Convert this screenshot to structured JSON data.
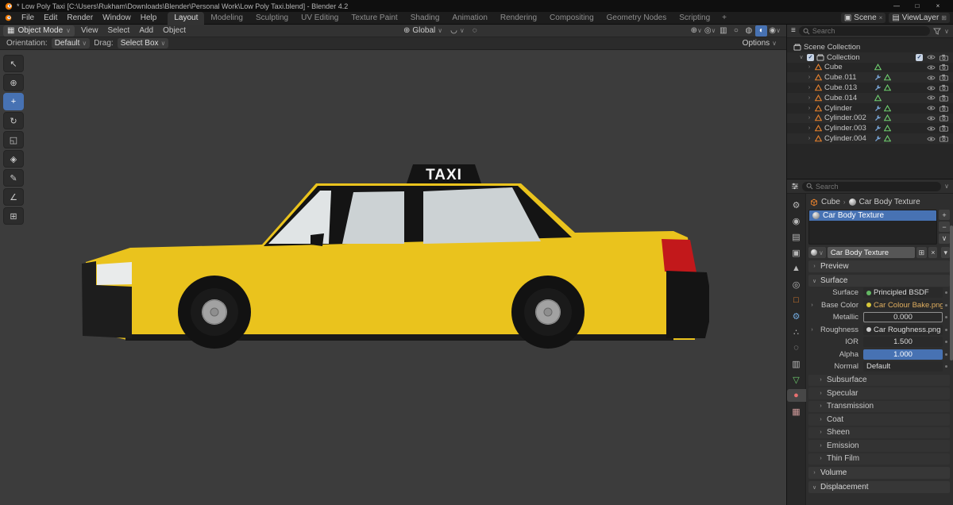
{
  "colors": {
    "accent": "#4772b3",
    "taxi_body": "#eac31d",
    "taxi_glass": "#ccd2d4",
    "taxi_windshield": "#e0e4e5",
    "taxi_taillight": "#c2181b",
    "viewport_bg": "#3c3c3c"
  },
  "icons": {
    "minimize": "—",
    "maximize": "□",
    "close": "×",
    "dropdown": "∨",
    "expand": "›",
    "open": "∨",
    "plus": "+",
    "minus": "−",
    "copy": "⊞",
    "crumb_sep": "›",
    "grid": "▦",
    "globe": "⊕",
    "magnet": "◡",
    "prop_edit": "◌",
    "scene_glyph": "▣",
    "layers_glyph": "▤",
    "funnel": "▾",
    "editor_outliner": "≡"
  },
  "titlebar": {
    "title": "* Low Poly Taxi [C:\\Users\\Rukham\\Downloads\\Blender\\Personal Work\\Low Poly Taxi.blend] - Blender 4.2"
  },
  "topbar": {
    "menus": [
      "File",
      "Edit",
      "Render",
      "Window",
      "Help"
    ],
    "workspaces": [
      "Layout",
      "Modeling",
      "Sculpting",
      "UV Editing",
      "Texture Paint",
      "Shading",
      "Animation",
      "Rendering",
      "Compositing",
      "Geometry Nodes",
      "Scripting"
    ],
    "active_workspace": "Layout",
    "add_tab": "+",
    "scene": "Scene",
    "view_layer": "ViewLayer"
  },
  "viewport_header": {
    "mode": "Object Mode",
    "menus": [
      "View",
      "Select",
      "Add",
      "Object"
    ],
    "orientation": "Global",
    "right_icons": [
      {
        "name": "show-gizmo",
        "glyph": "⊕",
        "dd": true
      },
      {
        "name": "show-overlays",
        "glyph": "◎",
        "dd": true
      },
      {
        "name": "toggle-xray",
        "glyph": "▥"
      },
      {
        "name": "shading-wireframe",
        "glyph": "○"
      },
      {
        "name": "shading-solid",
        "glyph": "◍"
      },
      {
        "name": "shading-material-preview",
        "glyph": "◐",
        "active": true
      },
      {
        "name": "shading-rendered",
        "glyph": "◉",
        "dd": true
      }
    ]
  },
  "tool_settings": {
    "orientation_label": "Orientation:",
    "orientation_value": "Default",
    "drag_label": "Drag:",
    "drag_value": "Select Box",
    "options": "Options"
  },
  "toolbar": [
    {
      "name": "tweak-select",
      "glyph": "↖"
    },
    {
      "name": "cursor",
      "glyph": "⊕"
    },
    {
      "name": "move",
      "glyph": "+",
      "active": true
    },
    {
      "name": "rotate",
      "glyph": "↻"
    },
    {
      "name": "scale",
      "glyph": "◱"
    },
    {
      "name": "transform",
      "glyph": "◈"
    },
    {
      "name": "annotate",
      "glyph": "✎"
    },
    {
      "name": "measure",
      "glyph": "∠"
    },
    {
      "name": "add-cube",
      "glyph": "⊞"
    }
  ],
  "viewport": {
    "taxi_sign": "TAXI"
  },
  "outliner": {
    "search_placeholder": "Search",
    "scene_collection": "Scene Collection",
    "collection": "Collection",
    "items": [
      {
        "name": "Cube",
        "wrench": false
      },
      {
        "name": "Cube.011",
        "wrench": true
      },
      {
        "name": "Cube.013",
        "wrench": true
      },
      {
        "name": "Cube.014",
        "wrench": false
      },
      {
        "name": "Cylinder",
        "wrench": true
      },
      {
        "name": "Cylinder.002",
        "wrench": true
      },
      {
        "name": "Cylinder.003",
        "wrench": true
      },
      {
        "name": "Cylinder.004",
        "wrench": true
      }
    ]
  },
  "properties": {
    "search_placeholder": "Search",
    "breadcrumb_object": "Cube",
    "breadcrumb_material": "Car Body Texture",
    "slot_name": "Car Body Texture",
    "material_name": "Car Body Texture",
    "tabs": [
      {
        "name": "tool",
        "glyph": "⚙",
        "color": "#b8b8b8"
      },
      {
        "name": "render",
        "glyph": "◉",
        "color": "#b8b8b8"
      },
      {
        "name": "output",
        "glyph": "▤",
        "color": "#b8b8b8"
      },
      {
        "name": "view-layer",
        "glyph": "▣",
        "color": "#b8b8b8"
      },
      {
        "name": "scene",
        "glyph": "▲",
        "color": "#b8b8b8"
      },
      {
        "name": "world",
        "glyph": "◎",
        "color": "#b8b8b8"
      },
      {
        "name": "object",
        "glyph": "□",
        "color": "#e8822d"
      },
      {
        "name": "modifiers",
        "glyph": "⚙",
        "color": "#71a8dc"
      },
      {
        "name": "particles",
        "glyph": "∴",
        "color": "#b8b8b8"
      },
      {
        "name": "physics",
        "glyph": "◌",
        "color": "#b8b8b8"
      },
      {
        "name": "constraints",
        "glyph": "▥",
        "color": "#b8b8b8"
      },
      {
        "name": "object-data",
        "glyph": "▽",
        "color": "#6fcf6f"
      },
      {
        "name": "material",
        "glyph": "●",
        "color": "#e87070",
        "active": true
      },
      {
        "name": "texture",
        "glyph": "▦",
        "color": "#cf9a9a"
      }
    ],
    "panels": {
      "preview": "Preview",
      "surface": "Surface",
      "volume": "Volume",
      "displacement": "Displacement"
    },
    "surface_rows": [
      {
        "label": "Surface",
        "value": "Principled BSDF",
        "kind": "menu",
        "dot": "#63b763"
      },
      {
        "label": "Base Color",
        "value": "Car Colour Bake.png",
        "kind": "menu",
        "dot": "#d6c63a",
        "expand": true,
        "text_color": "#e0ae5f"
      },
      {
        "label": "Metallic",
        "value": "0.000",
        "kind": "slider",
        "outlined": true
      },
      {
        "label": "Roughness",
        "value": "Car Roughness.png",
        "kind": "menu",
        "dot": "#cccccc",
        "expand": true
      },
      {
        "label": "IOR",
        "value": "1.500",
        "kind": "slider"
      },
      {
        "label": "Alpha",
        "value": "1.000",
        "kind": "slider",
        "filled": true
      },
      {
        "label": "Normal",
        "value": "Default",
        "kind": "menu"
      }
    ],
    "collapsed_sections": [
      "Subsurface",
      "Specular",
      "Transmission",
      "Coat",
      "Sheen",
      "Emission",
      "Thin Film"
    ]
  }
}
